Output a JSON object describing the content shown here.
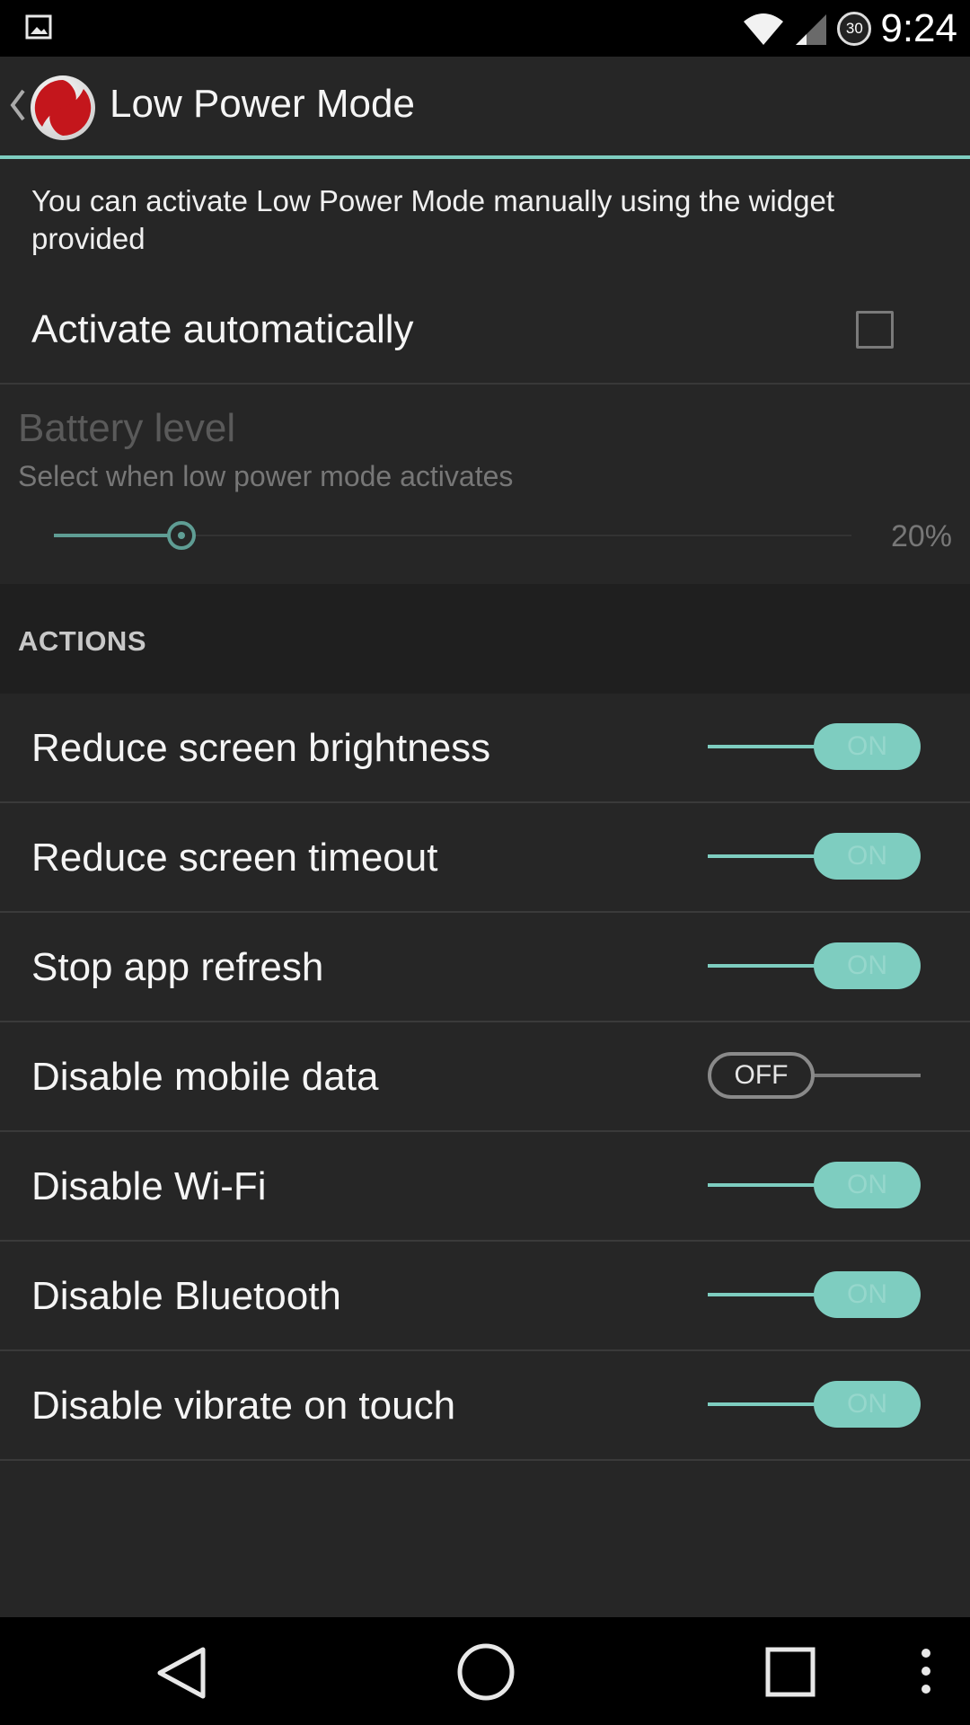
{
  "status_bar": {
    "time": "9:24",
    "battery_level": "30",
    "icons": [
      "image-notification-icon",
      "wifi-icon",
      "signal-icon",
      "battery-icon"
    ]
  },
  "action_bar": {
    "title": "Low Power Mode",
    "icons": [
      "back-chevron-icon",
      "app-logo-icon"
    ]
  },
  "info": {
    "text": "You can activate Low Power Mode manually using the widget provided"
  },
  "auto": {
    "label": "Activate automatically",
    "checked": false
  },
  "battery": {
    "title": "Battery level",
    "summary": "Select when low power mode activates",
    "value_label": "20%",
    "slider_fraction": 0.16
  },
  "actions": {
    "header": "ACTIONS",
    "items": [
      {
        "label": "Reduce screen brightness",
        "state": "ON"
      },
      {
        "label": "Reduce screen timeout",
        "state": "ON"
      },
      {
        "label": "Stop app refresh",
        "state": "ON"
      },
      {
        "label": "Disable mobile data",
        "state": "OFF"
      },
      {
        "label": "Disable Wi-Fi",
        "state": "ON"
      },
      {
        "label": "Disable Bluetooth",
        "state": "ON"
      },
      {
        "label": "Disable vibrate on touch",
        "state": "ON"
      }
    ]
  },
  "nav_bar": {
    "icons": [
      "back-icon",
      "home-icon",
      "recents-icon",
      "overflow-menu-icon"
    ]
  },
  "colors": {
    "accent": "#7ecdc0",
    "background": "#262626",
    "section_header_bg": "#1f1f1f"
  }
}
